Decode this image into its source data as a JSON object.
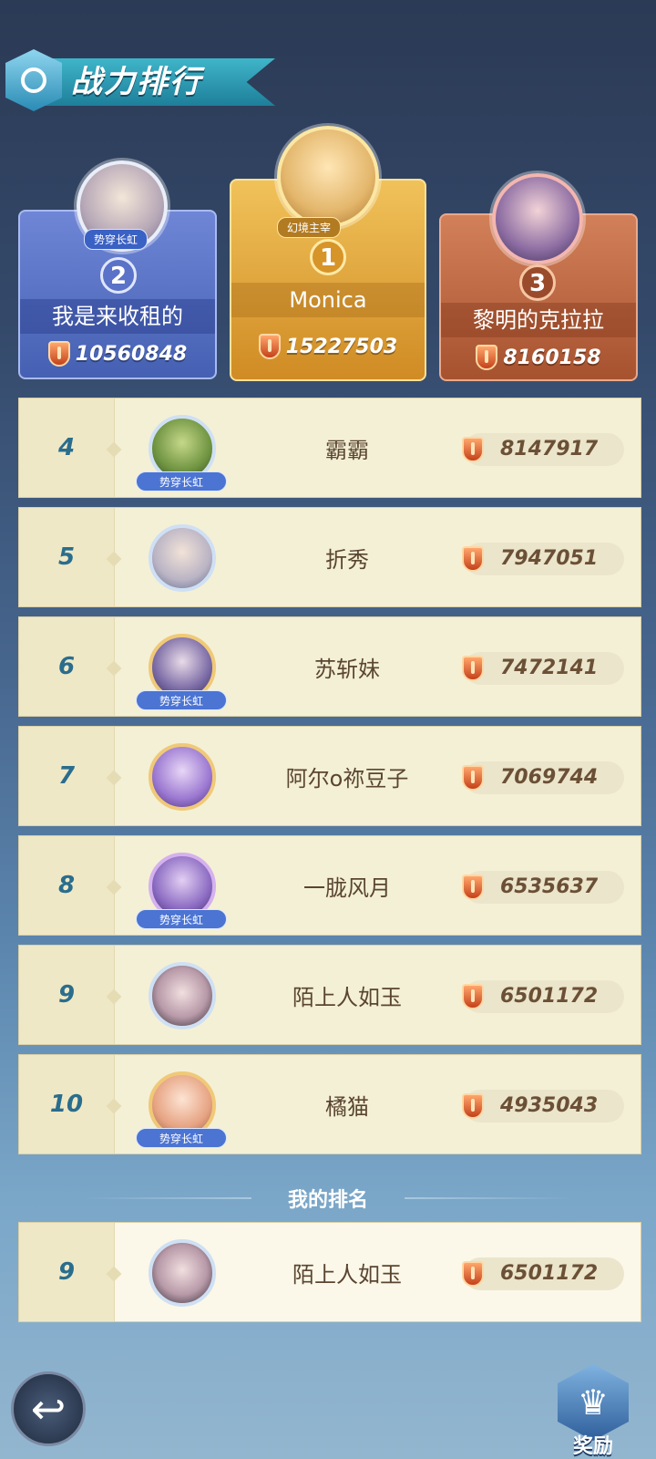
{
  "header": {
    "title": "战力排行"
  },
  "top3": [
    {
      "rank": "2",
      "name": "我是来收租的",
      "power": "10560848",
      "tag": "势穿长虹"
    },
    {
      "rank": "1",
      "name": "Monica",
      "power": "15227503",
      "tag": "幻境主宰"
    },
    {
      "rank": "3",
      "name": "黎明的克拉拉",
      "power": "8160158"
    }
  ],
  "list": [
    {
      "rank": "4",
      "name": "霸霸",
      "power": "8147917",
      "tag": "势穿长虹"
    },
    {
      "rank": "5",
      "name": "折秀",
      "power": "7947051"
    },
    {
      "rank": "6",
      "name": "苏斩妹",
      "power": "7472141",
      "tag": "势穿长虹"
    },
    {
      "rank": "7",
      "name": "阿尔o祢豆子",
      "power": "7069744"
    },
    {
      "rank": "8",
      "name": "一胧风月",
      "power": "6535637",
      "tag": "势穿长虹"
    },
    {
      "rank": "9",
      "name": "陌上人如玉",
      "power": "6501172"
    },
    {
      "rank": "10",
      "name": "橘猫",
      "power": "4935043",
      "tag": "势穿长虹"
    }
  ],
  "my_rank": {
    "label": "我的排名",
    "rank": "9",
    "name": "陌上人如玉",
    "power": "6501172"
  },
  "buttons": {
    "back_icon": "back-arrow-icon",
    "reward_label": "奖励"
  }
}
